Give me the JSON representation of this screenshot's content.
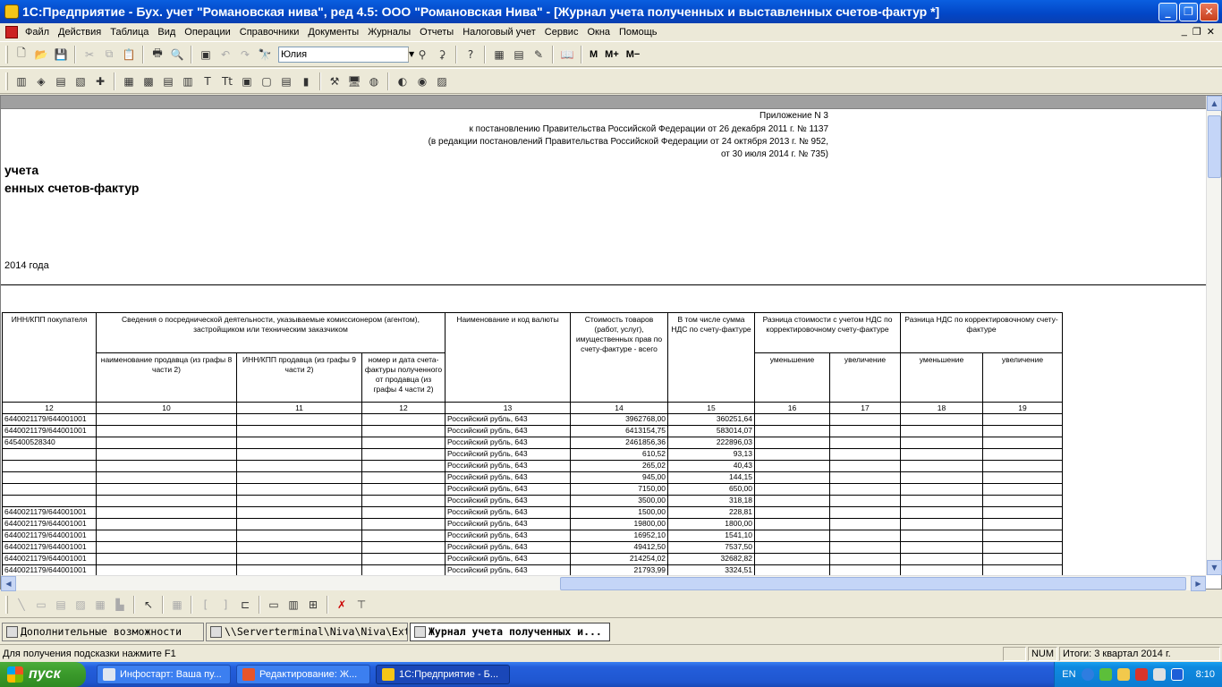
{
  "window": {
    "title": "1С:Предприятие - Бух. учет \"Романовская нива\", ред 4.5: ООО \"Романовская Нива\" - [Журнал учета полученных и выставленных счетов-фактур  *]",
    "minimize": "_",
    "restore": "❐",
    "close": "✕"
  },
  "menu": {
    "items": [
      "Файл",
      "Действия",
      "Таблица",
      "Вид",
      "Операции",
      "Справочники",
      "Документы",
      "Журналы",
      "Отчеты",
      "Налоговый учет",
      "Сервис",
      "Окна",
      "Помощь"
    ],
    "mdi": [
      "_",
      "❐",
      "✕"
    ]
  },
  "toolbar": {
    "user_combo_value": "Юлия",
    "m_label": "M",
    "mplus_label": "M+",
    "mminus_label": "M−"
  },
  "document": {
    "header_lines": [
      "Приложение N 3",
      "к постановлению Правительства Российской Федерации от 26 декабря 2011 г. № 1137",
      "(в редакции постановлений Правительства Российской Федерации от 24 октября 2013 г. № 952,",
      "от 30 июля 2014 г. № 735)"
    ],
    "title_line1": "учета",
    "title_line2": "енных счетов-фактур",
    "period": "2014 года",
    "table": {
      "h_inn_buyer": "ИНН/КПП покупателя",
      "h_intermediary": "Сведения о посреднической деятельности, указываемые комиссионером (агентом), застройщиком или техническим заказчиком",
      "h_seller_name": "наименование продавца (из графы 8 части 2)",
      "h_seller_inn": "ИНН/КПП продавца (из графы 9 части 2)",
      "h_invoice_no": "номер и дата счета-фактуры полученного от продавца (из графы 4 части 2)",
      "h_currency": "Наименование и код валюты",
      "h_cost": "Стоимость товаров (работ, услуг), имущественных прав по счету-фактуре - всего",
      "h_vat": "В том числе сумма НДС по счету-фактуре",
      "h_diff_cost": "Разница стоимости с учетом НДС по корректировочному счету-фактуре",
      "h_diff_vat": "Разница НДС по корректировочному счету-фактуре",
      "h_decrease": "уменьшение",
      "h_increase": "увеличение",
      "col_numbers": [
        "12",
        "10",
        "11",
        "12",
        "13",
        "14",
        "15",
        "16",
        "17",
        "18",
        "19"
      ],
      "rows": [
        {
          "inn": "6440021179/644001001",
          "cur": "Российский рубль, 643",
          "cost": "3962768,00",
          "vat": "360251,64"
        },
        {
          "inn": "6440021179/644001001",
          "cur": "Российский рубль, 643",
          "cost": "6413154,75",
          "vat": "583014,07"
        },
        {
          "inn": "645400528340",
          "cur": "Российский рубль, 643",
          "cost": "2461856,36",
          "vat": "222896,03"
        },
        {
          "inn": "",
          "cur": "Российский рубль, 643",
          "cost": "610,52",
          "vat": "93,13"
        },
        {
          "inn": "",
          "cur": "Российский рубль, 643",
          "cost": "265,02",
          "vat": "40,43"
        },
        {
          "inn": "",
          "cur": "Российский рубль, 643",
          "cost": "945,00",
          "vat": "144,15"
        },
        {
          "inn": "",
          "cur": "Российский рубль, 643",
          "cost": "7150,00",
          "vat": "650,00"
        },
        {
          "inn": "",
          "cur": "Российский рубль, 643",
          "cost": "3500,00",
          "vat": "318,18"
        },
        {
          "inn": "6440021179/644001001",
          "cur": "Российский рубль, 643",
          "cost": "1500,00",
          "vat": "228,81"
        },
        {
          "inn": "6440021179/644001001",
          "cur": "Российский рубль, 643",
          "cost": "19800,00",
          "vat": "1800,00"
        },
        {
          "inn": "6440021179/644001001",
          "cur": "Российский рубль, 643",
          "cost": "16952,10",
          "vat": "1541,10"
        },
        {
          "inn": "6440021179/644001001",
          "cur": "Российский рубль, 643",
          "cost": "49412,50",
          "vat": "7537,50"
        },
        {
          "inn": "6440021179/644001001",
          "cur": "Российский рубль, 643",
          "cost": "214254,02",
          "vat": "32682,82"
        },
        {
          "inn": "6440021179/644001001",
          "cur": "Российский рубль, 643",
          "cost": "21793,99",
          "vat": "3324,51"
        },
        {
          "inn": "",
          "cur": "",
          "cost": "",
          "vat": ""
        }
      ]
    }
  },
  "window_tabs": [
    {
      "label": "Дополнительные возможности"
    },
    {
      "label": "\\\\Serverterminal\\Niva\\Niva\\Ext..."
    },
    {
      "label": "Журнал учета полученных и..."
    }
  ],
  "status": {
    "hint": "Для получения подсказки нажмите F1",
    "num": "NUM",
    "totals": "Итоги: 3 квартал 2014 г."
  },
  "taskbar": {
    "start_label": "пуск",
    "tasks": [
      {
        "label": "Инфостарт: Ваша пу..."
      },
      {
        "label": "Редактирование: Ж..."
      },
      {
        "label": "1С:Предприятие - Б..."
      }
    ],
    "lang": "EN",
    "clock": "8:10"
  },
  "colors": {
    "titlebar": "#0246c6",
    "taskbar": "#245edb",
    "start": "#3c9c2c",
    "chrome": "#ece9d8"
  }
}
